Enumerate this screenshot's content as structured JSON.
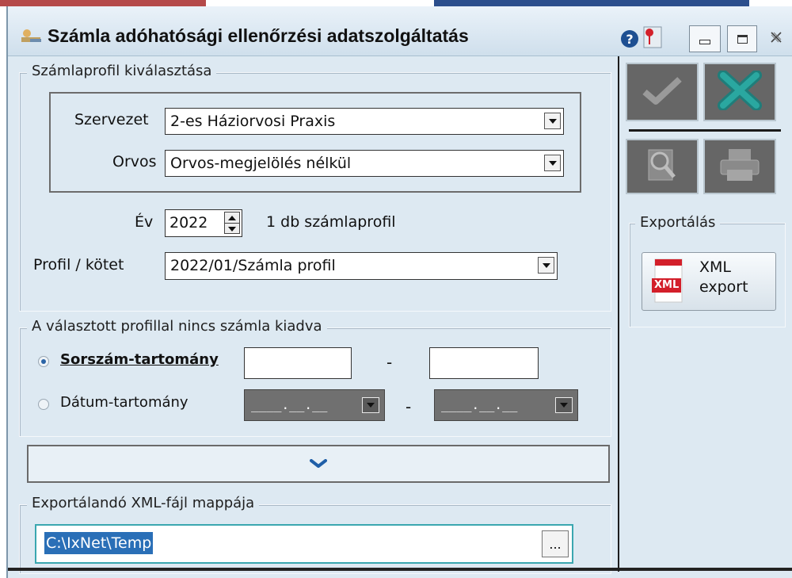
{
  "window": {
    "title": "Számla adóhatósági ellenőrzési adatszolgáltatás",
    "help_glyph": "?",
    "icons": [
      "app-icon",
      "help-icon",
      "pin-icon",
      "minimize-icon",
      "maximize-icon",
      "close-icon"
    ]
  },
  "profile_group": {
    "legend": "Számlaprofil kiválasztása",
    "szervezet_label": "Szervezet",
    "szervezet_value": "2-es Háziorvosi Praxis",
    "orvos_label": "Orvos",
    "orvos_value": "Orvos-megjelölés nélkül",
    "ev_label": "Év",
    "ev_value": "2022",
    "profile_count": "1 db számlaprofil",
    "kotet_label": "Profil / kötet",
    "kotet_value": "2022/01/Számla profil"
  },
  "range_group": {
    "legend": "A választott profillal nincs számla kiadva",
    "sorszam_label": "Sorszám-tartomány",
    "datum_label": "Dátum-tartomány",
    "separator": "-",
    "date_placeholder": "____.__.__"
  },
  "export_folder": {
    "legend": "Exportálandó XML-fájl mappája",
    "path": "C:\\IxNet\\Temp",
    "browse_label": "..."
  },
  "right_panel": {
    "export_legend": "Exportálás",
    "xml_badge": "XML",
    "xml_button_label": "XML\nexport"
  },
  "colors": {
    "window_bg": "#dde9f2",
    "selection": "#2a6fb7",
    "disabled_button": "#666666",
    "ok_check": "#9a9a9a",
    "cancel_x": "#1f7d7a",
    "expander_chevron": "#1f5fa8"
  }
}
